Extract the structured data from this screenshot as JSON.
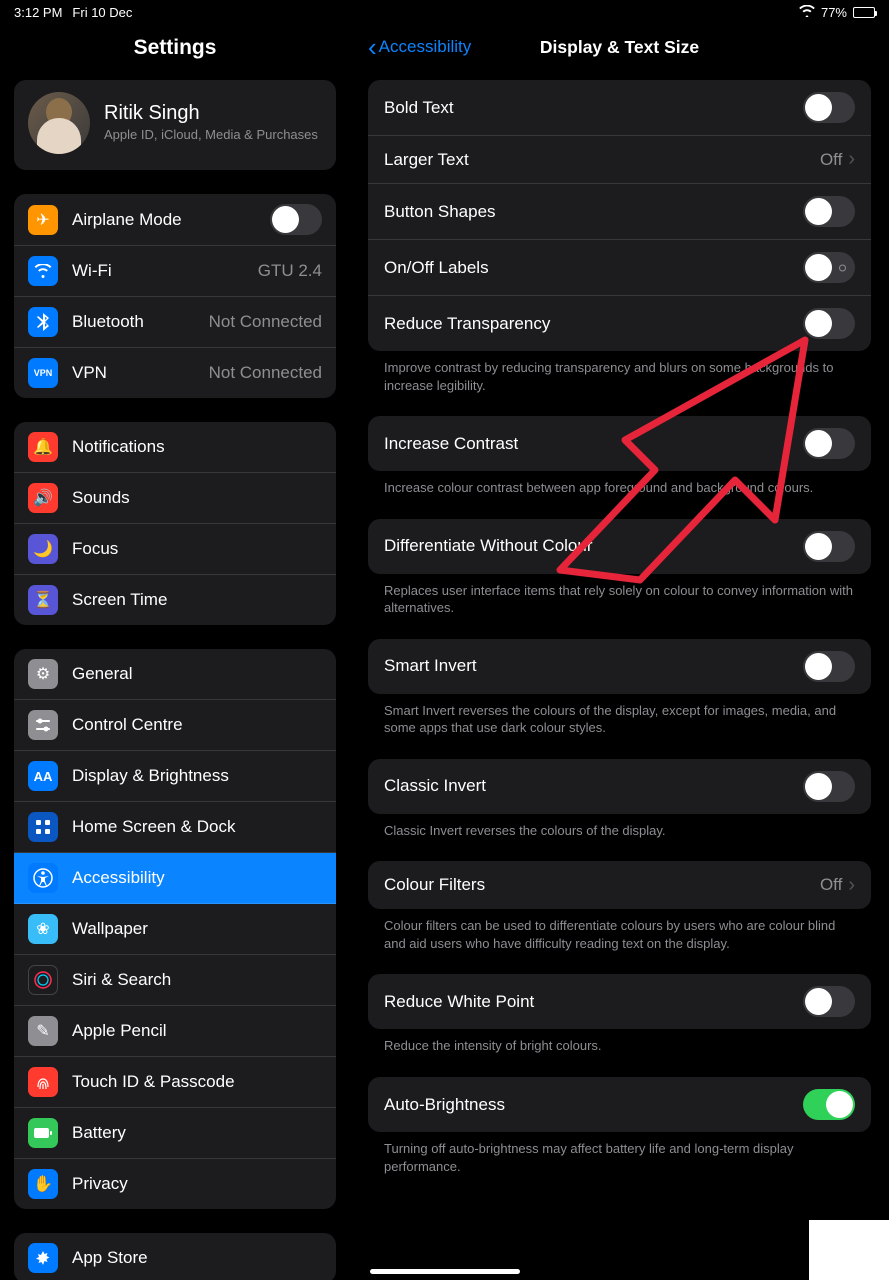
{
  "status": {
    "time": "3:12 PM",
    "date": "Fri 10 Dec",
    "battery_percent": "77%"
  },
  "sidebar": {
    "title": "Settings",
    "profile": {
      "name": "Ritik Singh",
      "sub": "Apple ID, iCloud, Media & Purchases"
    },
    "group1": {
      "airplane": "Airplane Mode",
      "wifi": "Wi-Fi",
      "wifi_value": "GTU 2.4",
      "bluetooth": "Bluetooth",
      "bluetooth_value": "Not Connected",
      "vpn": "VPN",
      "vpn_value": "Not Connected"
    },
    "group2": {
      "notifications": "Notifications",
      "sounds": "Sounds",
      "focus": "Focus",
      "screentime": "Screen Time"
    },
    "group3": {
      "general": "General",
      "control": "Control Centre",
      "display": "Display & Brightness",
      "home": "Home Screen & Dock",
      "accessibility": "Accessibility",
      "wallpaper": "Wallpaper",
      "siri": "Siri & Search",
      "pencil": "Apple Pencil",
      "touchid": "Touch ID & Passcode",
      "battery": "Battery",
      "privacy": "Privacy"
    },
    "group4": {
      "appstore": "App Store"
    }
  },
  "main": {
    "back": "Accessibility",
    "title": "Display & Text Size",
    "bold": "Bold Text",
    "larger": "Larger Text",
    "larger_value": "Off",
    "shapes": "Button Shapes",
    "onoff": "On/Off Labels",
    "reduce_trans": "Reduce Transparency",
    "reduce_trans_help": "Improve contrast by reducing transparency and blurs on some backgrounds to increase legibility.",
    "contrast": "Increase Contrast",
    "contrast_help": "Increase colour contrast between app foreground and background colours.",
    "diff": "Differentiate Without Colour",
    "diff_help": "Replaces user interface items that rely solely on colour to convey information with alternatives.",
    "smart": "Smart Invert",
    "smart_help": "Smart Invert reverses the colours of the display, except for images, media, and some apps that use dark colour styles.",
    "classic": "Classic Invert",
    "classic_help": "Classic Invert reverses the colours of the display.",
    "filters": "Colour Filters",
    "filters_value": "Off",
    "filters_help": "Colour filters can be used to differentiate colours by users who are colour blind and aid users who have difficulty reading text on the display.",
    "white": "Reduce White Point",
    "white_help": "Reduce the intensity of bright colours.",
    "auto": "Auto-Brightness",
    "auto_help": "Turning off auto-brightness may affect battery life and long-term display performance."
  }
}
